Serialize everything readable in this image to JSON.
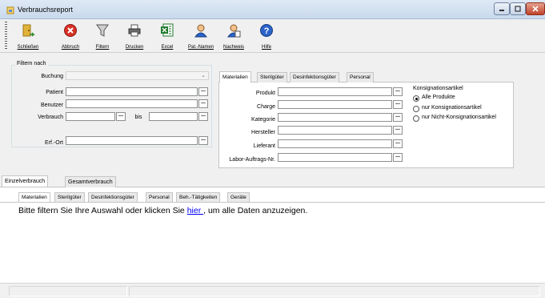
{
  "window": {
    "title": "Verbrauchsreport",
    "controls": {
      "minimize": "minimize-icon",
      "maximize": "maximize-icon",
      "close": "close-icon"
    }
  },
  "toolbar": {
    "buttons": [
      {
        "label": "Schließen",
        "icon": "exit-door-icon",
        "color": "#d2a020"
      },
      {
        "label": "Abbruch",
        "icon": "cancel-icon",
        "color": "#d93025"
      },
      {
        "label": "Filtern",
        "icon": "filter-icon",
        "color": "#707070"
      },
      {
        "label": "Drucken",
        "icon": "printer-icon",
        "color": "#505050"
      },
      {
        "label": "Excel",
        "icon": "excel-icon",
        "color": "#1d7a2a"
      },
      {
        "label": "Pat.-Namen",
        "icon": "patient-icon",
        "color": "#2b63c9"
      },
      {
        "label": "Nachweis",
        "icon": "proof-icon",
        "color": "#2b63c9"
      },
      {
        "label": "Hilfe",
        "icon": "help-icon",
        "color": "#2b63c9"
      }
    ]
  },
  "filter": {
    "legend": "Filtern nach",
    "buchung": {
      "label": "Buchung",
      "value": ""
    },
    "patient": {
      "label": "Patient",
      "value": ""
    },
    "benutzer": {
      "label": "Benutzer",
      "value": ""
    },
    "verbrauch": {
      "label": "Verbrauch",
      "value_from": "",
      "bis_label": "bis",
      "value_to": ""
    },
    "erf_ort": {
      "label": "Erf.-Ort",
      "value": ""
    }
  },
  "right_tabs": {
    "tabs": [
      "Materialien",
      "Sterilgüter",
      "Desinfektionsgüter",
      "Personal"
    ],
    "active": "Materialien",
    "fields": [
      {
        "label": "Produkt",
        "value": ""
      },
      {
        "label": "Charge",
        "value": ""
      },
      {
        "label": "Kategorie",
        "value": ""
      },
      {
        "label": "Hersteller",
        "value": ""
      },
      {
        "label": "Lieferant",
        "value": ""
      },
      {
        "label": "Labor-Auftrags-Nr.",
        "value": ""
      }
    ],
    "konsignation": {
      "title": "Konsignationsartikel",
      "options": [
        "Alle Produkte",
        "nur Konsignationsartikel",
        "nur Nicht-Konsignationsartikel"
      ],
      "selected": "Alle Produkte"
    }
  },
  "bottom_tabs": {
    "tabs": [
      "Einzelverbrauch",
      "Gesamtverbrauch"
    ],
    "active": "Einzelverbrauch",
    "subtabs": [
      "Materialien",
      "Sterilgüter",
      "Desinfektionsgüter",
      "Personal",
      "Beh.-Tätigkeiten",
      "Geräte"
    ],
    "active_subtab": "Materialien",
    "message_before": "Bitte filtern Sie Ihre Auswahl oder klicken Sie ",
    "message_link": " hier ",
    "message_after": ", um alle Daten anzuzeigen."
  }
}
